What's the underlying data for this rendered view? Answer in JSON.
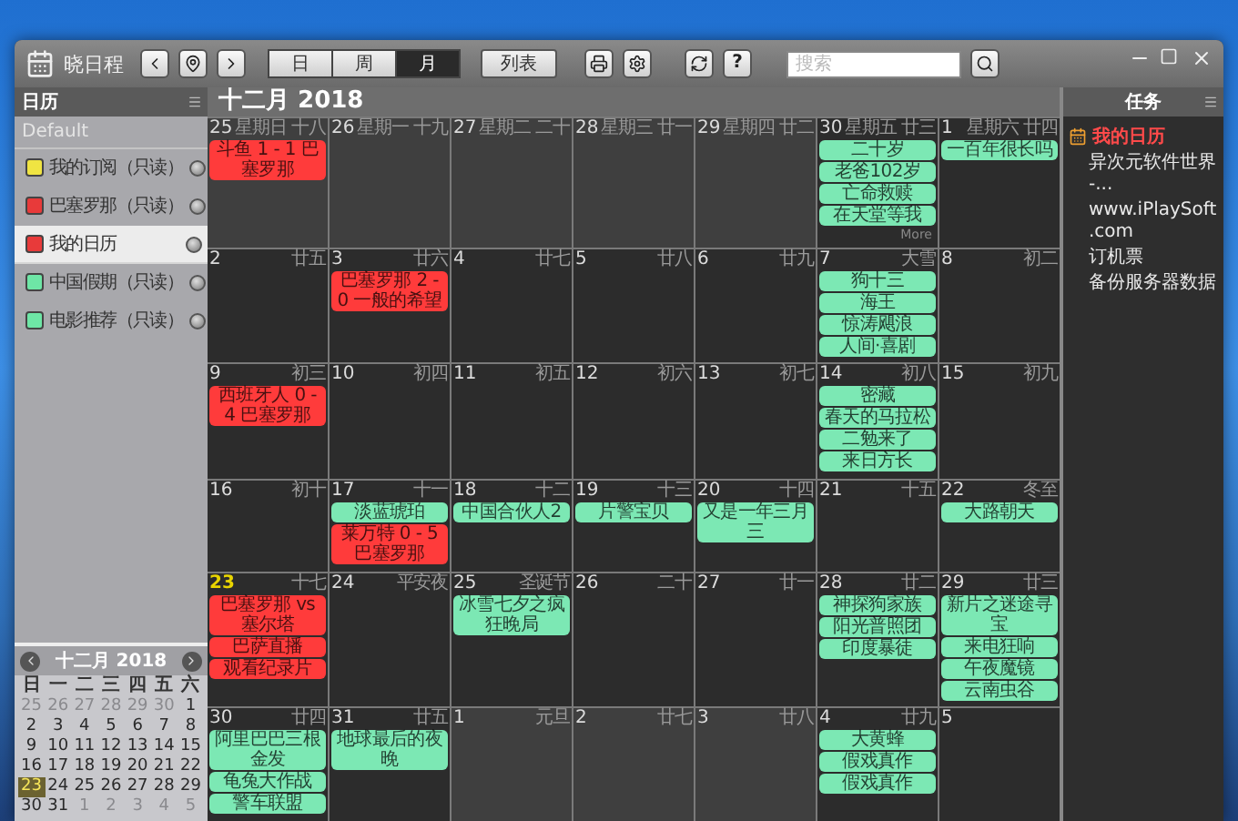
{
  "window": {
    "app_name": "晓日程"
  },
  "toolbar": {
    "views": [
      {
        "label": "日",
        "selected": false
      },
      {
        "label": "周",
        "selected": false
      },
      {
        "label": "月",
        "selected": true
      }
    ],
    "list_button": "列表",
    "help_button": "?",
    "search": {
      "placeholder": "搜索"
    }
  },
  "sidebar": {
    "title": "日历",
    "group": "Default",
    "calendars": [
      {
        "name": "我的订阅（只读）",
        "color": "#f0e442",
        "selected": false
      },
      {
        "name": "巴塞罗那（只读）",
        "color": "#e83a3a",
        "selected": false
      },
      {
        "name": "我的日历",
        "color": "#e83a3a",
        "selected": true
      },
      {
        "name": "中国假期（只读）",
        "color": "#6ee6a6",
        "selected": false
      },
      {
        "name": "电影推荐（只读）",
        "color": "#6ee6a6",
        "selected": false
      }
    ],
    "mini_calendar": {
      "title": "十二月 2018",
      "weekdays": [
        "日",
        "一",
        "二",
        "三",
        "四",
        "五",
        "六"
      ],
      "weeks": [
        [
          {
            "day": "25",
            "outside": true,
            "today": false
          },
          {
            "day": "26",
            "outside": true,
            "today": false
          },
          {
            "day": "27",
            "outside": true,
            "today": false
          },
          {
            "day": "28",
            "outside": true,
            "today": false
          },
          {
            "day": "29",
            "outside": true,
            "today": false
          },
          {
            "day": "30",
            "outside": true,
            "today": false
          },
          {
            "day": "1",
            "outside": false,
            "today": false
          }
        ],
        [
          {
            "day": "2",
            "outside": false,
            "today": false
          },
          {
            "day": "3",
            "outside": false,
            "today": false
          },
          {
            "day": "4",
            "outside": false,
            "today": false
          },
          {
            "day": "5",
            "outside": false,
            "today": false
          },
          {
            "day": "6",
            "outside": false,
            "today": false
          },
          {
            "day": "7",
            "outside": false,
            "today": false
          },
          {
            "day": "8",
            "outside": false,
            "today": false
          }
        ],
        [
          {
            "day": "9",
            "outside": false,
            "today": false
          },
          {
            "day": "10",
            "outside": false,
            "today": false
          },
          {
            "day": "11",
            "outside": false,
            "today": false
          },
          {
            "day": "12",
            "outside": false,
            "today": false
          },
          {
            "day": "13",
            "outside": false,
            "today": false
          },
          {
            "day": "14",
            "outside": false,
            "today": false
          },
          {
            "day": "15",
            "outside": false,
            "today": false
          }
        ],
        [
          {
            "day": "16",
            "outside": false,
            "today": false
          },
          {
            "day": "17",
            "outside": false,
            "today": false
          },
          {
            "day": "18",
            "outside": false,
            "today": false
          },
          {
            "day": "19",
            "outside": false,
            "today": false
          },
          {
            "day": "20",
            "outside": false,
            "today": false
          },
          {
            "day": "21",
            "outside": false,
            "today": false
          },
          {
            "day": "22",
            "outside": false,
            "today": false
          }
        ],
        [
          {
            "day": "23",
            "outside": false,
            "today": true
          },
          {
            "day": "24",
            "outside": false,
            "today": false
          },
          {
            "day": "25",
            "outside": false,
            "today": false
          },
          {
            "day": "26",
            "outside": false,
            "today": false
          },
          {
            "day": "27",
            "outside": false,
            "today": false
          },
          {
            "day": "28",
            "outside": false,
            "today": false
          },
          {
            "day": "29",
            "outside": false,
            "today": false
          }
        ],
        [
          {
            "day": "30",
            "outside": false,
            "today": false
          },
          {
            "day": "31",
            "outside": false,
            "today": false
          },
          {
            "day": "1",
            "outside": true,
            "today": false
          },
          {
            "day": "2",
            "outside": true,
            "today": false
          },
          {
            "day": "3",
            "outside": true,
            "today": false
          },
          {
            "day": "4",
            "outside": true,
            "today": false
          },
          {
            "day": "5",
            "outside": true,
            "today": false
          }
        ]
      ]
    }
  },
  "calendar": {
    "title": "十二月 2018",
    "weeks": [
      [
        {
          "day": "25",
          "weekday": "星期日",
          "label": "十八",
          "dimmed": true,
          "today": false,
          "events": [
            {
              "title": "斗鱼 1 - 1 巴塞罗那",
              "color": "#ff3b3b"
            }
          ]
        },
        {
          "day": "26",
          "weekday": "星期一",
          "label": "十九",
          "dimmed": true,
          "today": false
        },
        {
          "day": "27",
          "weekday": "星期二",
          "label": "二十",
          "dimmed": true,
          "today": false
        },
        {
          "day": "28",
          "weekday": "星期三",
          "label": "廿一",
          "dimmed": true,
          "today": false
        },
        {
          "day": "29",
          "weekday": "星期四",
          "label": "廿二",
          "dimmed": true,
          "today": false
        },
        {
          "day": "30",
          "weekday": "星期五",
          "label": "廿三",
          "dimmed": false,
          "today": false,
          "more": "More",
          "events": [
            {
              "title": "二十岁",
              "color": "#7ce8b4"
            },
            {
              "title": "老爸102岁",
              "color": "#7ce8b4"
            },
            {
              "title": "亡命救赎",
              "color": "#7ce8b4"
            },
            {
              "title": "在天堂等我",
              "color": "#7ce8b4"
            }
          ]
        },
        {
          "day": "1",
          "weekday": "星期六",
          "label": "廿四",
          "dimmed": false,
          "today": false,
          "events": [
            {
              "title": "一百年很长吗",
              "color": "#7ce8b4"
            }
          ]
        }
      ],
      [
        {
          "day": "2",
          "label": "廿五",
          "dimmed": false,
          "today": false
        },
        {
          "day": "3",
          "label": "廿六",
          "dimmed": false,
          "today": false,
          "events": [
            {
              "title": "巴塞罗那 2 - 0 一般的希望",
              "color": "#ff3b3b"
            }
          ]
        },
        {
          "day": "4",
          "label": "廿七",
          "dimmed": false,
          "today": false
        },
        {
          "day": "5",
          "label": "廿八",
          "dimmed": false,
          "today": false
        },
        {
          "day": "6",
          "label": "廿九",
          "dimmed": false,
          "today": false
        },
        {
          "day": "7",
          "label": "大雪",
          "dimmed": false,
          "today": false,
          "events": [
            {
              "title": "狗十三",
              "color": "#7ce8b4"
            },
            {
              "title": "海王",
              "color": "#7ce8b4"
            },
            {
              "title": "惊涛飓浪",
              "color": "#7ce8b4"
            },
            {
              "title": "人间·喜剧",
              "color": "#7ce8b4"
            }
          ]
        },
        {
          "day": "8",
          "label": "初二",
          "dimmed": false,
          "today": false
        }
      ],
      [
        {
          "day": "9",
          "label": "初三",
          "dimmed": false,
          "today": false,
          "events": [
            {
              "title": "西班牙人 0 - 4 巴塞罗那",
              "color": "#ff3b3b"
            }
          ]
        },
        {
          "day": "10",
          "label": "初四",
          "dimmed": false,
          "today": false
        },
        {
          "day": "11",
          "label": "初五",
          "dimmed": false,
          "today": false
        },
        {
          "day": "12",
          "label": "初六",
          "dimmed": false,
          "today": false
        },
        {
          "day": "13",
          "label": "初七",
          "dimmed": false,
          "today": false
        },
        {
          "day": "14",
          "label": "初八",
          "dimmed": false,
          "today": false,
          "events": [
            {
              "title": "密藏",
              "color": "#7ce8b4"
            },
            {
              "title": "春天的马拉松",
              "color": "#7ce8b4"
            },
            {
              "title": "二勉来了",
              "color": "#7ce8b4"
            },
            {
              "title": "来日方长",
              "color": "#7ce8b4"
            }
          ]
        },
        {
          "day": "15",
          "label": "初九",
          "dimmed": false,
          "today": false
        }
      ],
      [
        {
          "day": "16",
          "label": "初十",
          "dimmed": false,
          "today": false
        },
        {
          "day": "17",
          "label": "十一",
          "dimmed": false,
          "today": false,
          "events": [
            {
              "title": "淡蓝琥珀",
              "color": "#7ce8b4"
            },
            {
              "title": "莱万特 0 - 5 巴塞罗那",
              "color": "#ff3b3b"
            }
          ]
        },
        {
          "day": "18",
          "label": "十二",
          "dimmed": false,
          "today": false,
          "events": [
            {
              "title": "中国合伙人2",
              "color": "#7ce8b4"
            }
          ]
        },
        {
          "day": "19",
          "label": "十三",
          "dimmed": false,
          "today": false,
          "events": [
            {
              "title": "片警宝贝",
              "color": "#7ce8b4"
            }
          ]
        },
        {
          "day": "20",
          "label": "十四",
          "dimmed": false,
          "today": false,
          "events": [
            {
              "title": "又是一年三月三",
              "color": "#7ce8b4"
            }
          ]
        },
        {
          "day": "21",
          "label": "十五",
          "dimmed": false,
          "today": false
        },
        {
          "day": "22",
          "label": "冬至",
          "dimmed": false,
          "today": false,
          "events": [
            {
              "title": "大路朝天",
              "color": "#7ce8b4"
            }
          ]
        }
      ],
      [
        {
          "day": "23",
          "label": "十七",
          "dimmed": false,
          "today": true,
          "events": [
            {
              "title": "巴塞罗那 vs 塞尔塔",
              "color": "#ff3b3b"
            },
            {
              "title": "巴萨直播",
              "color": "#ff3b3b"
            },
            {
              "title": "观看纪录片",
              "color": "#ff3b3b"
            }
          ]
        },
        {
          "day": "24",
          "label": "平安夜",
          "dimmed": false,
          "today": false
        },
        {
          "day": "25",
          "label": "圣诞节",
          "dimmed": false,
          "today": false,
          "events": [
            {
              "title": "冰雪七夕之疯狂晚局",
              "color": "#7ce8b4"
            }
          ]
        },
        {
          "day": "26",
          "label": "二十",
          "dimmed": false,
          "today": false
        },
        {
          "day": "27",
          "label": "廿一",
          "dimmed": false,
          "today": false
        },
        {
          "day": "28",
          "label": "廿二",
          "dimmed": false,
          "today": false,
          "events": [
            {
              "title": "神探狗家族",
              "color": "#7ce8b4"
            },
            {
              "title": "阳光普照团",
              "color": "#7ce8b4"
            },
            {
              "title": "印度暴徒",
              "color": "#7ce8b4"
            }
          ]
        },
        {
          "day": "29",
          "label": "廿三",
          "dimmed": false,
          "today": false,
          "events": [
            {
              "title": "新片之迷途寻宝",
              "color": "#7ce8b4"
            },
            {
              "title": "来电狂响",
              "color": "#7ce8b4"
            },
            {
              "title": "午夜魔镜",
              "color": "#7ce8b4"
            },
            {
              "title": "云南虫谷",
              "color": "#7ce8b4"
            }
          ]
        }
      ],
      [
        {
          "day": "30",
          "label": "廿四",
          "dimmed": false,
          "today": false,
          "events": [
            {
              "title": "阿里巴巴三根金发",
              "color": "#7ce8b4"
            },
            {
              "title": "龟兔大作战",
              "color": "#7ce8b4"
            },
            {
              "title": "警车联盟",
              "color": "#7ce8b4"
            }
          ]
        },
        {
          "day": "31",
          "label": "廿五",
          "dimmed": false,
          "today": false,
          "events": [
            {
              "title": "地球最后的夜晚",
              "color": "#7ce8b4"
            }
          ]
        },
        {
          "day": "1",
          "label": "元旦",
          "dimmed": true,
          "today": false
        },
        {
          "day": "2",
          "label": "廿七",
          "dimmed": true,
          "today": false
        },
        {
          "day": "3",
          "label": "廿八",
          "dimmed": true,
          "today": false
        },
        {
          "day": "4",
          "label": "廿九",
          "dimmed": false,
          "today": false,
          "events": [
            {
              "title": "大黄蜂",
              "color": "#7ce8b4"
            },
            {
              "title": "假戏真作",
              "color": "#7ce8b4"
            },
            {
              "title": "假戏真作",
              "color": "#7ce8b4"
            }
          ]
        },
        {
          "day": "5",
          "dimmed": false,
          "today": false
        }
      ]
    ]
  },
  "tasks": {
    "title": "任务",
    "calendar_name": "我的日历",
    "items": [
      "异次元软件世界 -...",
      "www.iPlaySoft.com",
      "订机票",
      "备份服务器数据"
    ]
  }
}
